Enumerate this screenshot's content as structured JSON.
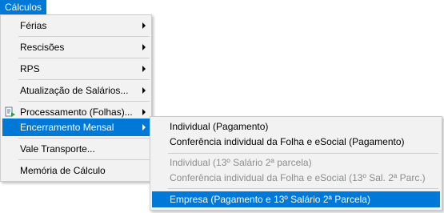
{
  "menubar": {
    "title": "Cálculos"
  },
  "menu": {
    "items": [
      {
        "label": "Férias"
      },
      {
        "label": "Rescisões"
      },
      {
        "label": "RPS"
      },
      {
        "label": "Atualização de Salários..."
      },
      {
        "label": "Processamento (Folhas)...",
        "icon": "document-process-icon"
      },
      {
        "label": "Encerramento Mensal"
      },
      {
        "label": "Vale Transporte..."
      },
      {
        "label": "Memória de Cálculo"
      }
    ]
  },
  "submenu": {
    "items": [
      {
        "label": "Individual (Pagamento)"
      },
      {
        "label": "Conferência individual da Folha e eSocial (Pagamento)"
      },
      {
        "label": "Individual (13º Salário 2ª parcela)"
      },
      {
        "label": "Conferência individual da Folha e eSocial (13º Sal. 2ª Parc.)"
      },
      {
        "label": "Empresa (Pagamento e 13º Salário 2ª Parcela)"
      }
    ]
  },
  "colors": {
    "highlight": "#0078d7",
    "menu_background": "#f2f2f2",
    "disabled_text": "#8d8d8d"
  }
}
